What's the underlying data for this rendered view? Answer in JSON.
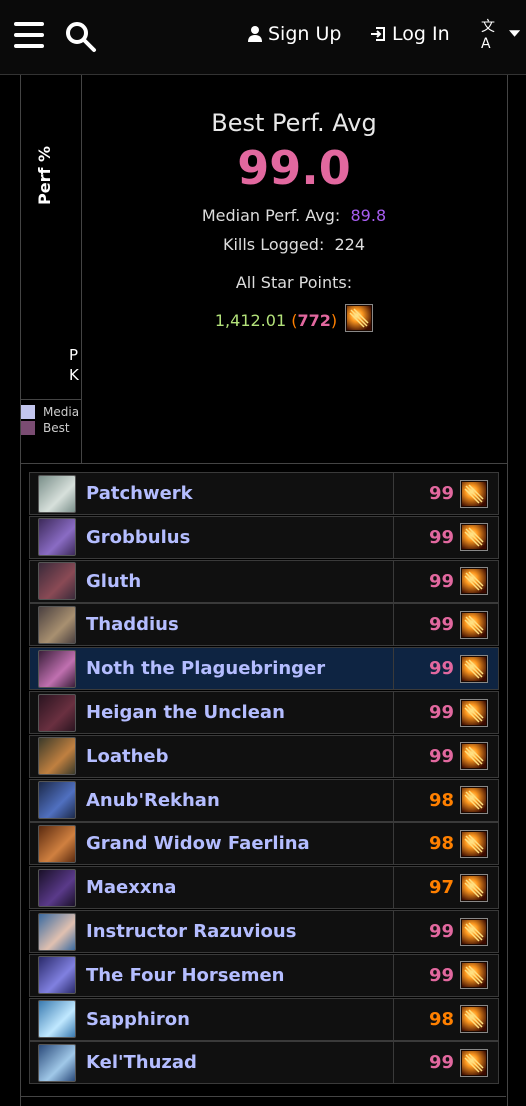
{
  "nav": {
    "signup": "Sign Up",
    "login": "Log In",
    "lang_glyph": "文A"
  },
  "stats": {
    "side_title": "Perf %",
    "side_pk": [
      "P",
      "K"
    ],
    "legend": [
      {
        "label": "Media",
        "color": "#c3c6ee"
      },
      {
        "label": "Best",
        "color": "#7a4c72"
      }
    ],
    "best_label": "Best Perf. Avg",
    "best_value": "99.0",
    "median_label": "Median Perf. Avg:",
    "median_value": "89.8",
    "kills_label": "Kills Logged:",
    "kills_value": "224",
    "star_label": "All Star Points:",
    "star_points": "1,412.01",
    "star_rank": "772"
  },
  "colors": {
    "pink": "#e2689f",
    "orange": "#ff8000",
    "name": "#b4bdff"
  },
  "bosses": [
    {
      "name": "Patchwerk",
      "score": "99",
      "tier": "pink",
      "av": [
        "#7a8f8a",
        "#d7e0db"
      ]
    },
    {
      "name": "Grobbulus",
      "score": "99",
      "tier": "pink",
      "av": [
        "#3d2a5a",
        "#8a6cc4"
      ]
    },
    {
      "name": "Gluth",
      "score": "99",
      "tier": "pink",
      "av": [
        "#3a2a3a",
        "#8a4a55"
      ]
    },
    {
      "name": "Thaddius",
      "score": "99",
      "tier": "pink",
      "av": [
        "#4a4040",
        "#a89070"
      ]
    },
    {
      "name": "Noth the Plaguebringer",
      "score": "99",
      "tier": "pink",
      "av": [
        "#3a1f3a",
        "#c070b0"
      ],
      "highlight": true
    },
    {
      "name": "Heigan the Unclean",
      "score": "99",
      "tier": "pink",
      "av": [
        "#2a1420",
        "#6a3040"
      ]
    },
    {
      "name": "Loatheb",
      "score": "99",
      "tier": "pink",
      "av": [
        "#3a3a2a",
        "#c08040"
      ]
    },
    {
      "name": "Anub'Rekhan",
      "score": "98",
      "tier": "orange",
      "av": [
        "#1c2a4a",
        "#5070c0"
      ]
    },
    {
      "name": "Grand Widow Faerlina",
      "score": "98",
      "tier": "orange",
      "av": [
        "#5a2a10",
        "#d08040"
      ]
    },
    {
      "name": "Maexxna",
      "score": "97",
      "tier": "orange",
      "av": [
        "#1a1028",
        "#5a3a8a"
      ]
    },
    {
      "name": "Instructor Razuvious",
      "score": "99",
      "tier": "pink",
      "av": [
        "#3a6aa0",
        "#e0c0b0"
      ]
    },
    {
      "name": "The Four Horsemen",
      "score": "99",
      "tier": "pink",
      "av": [
        "#2a2a6a",
        "#8080e0"
      ]
    },
    {
      "name": "Sapphiron",
      "score": "98",
      "tier": "orange",
      "av": [
        "#3a7ab0",
        "#c0e8ff"
      ]
    },
    {
      "name": "Kel'Thuzad",
      "score": "99",
      "tier": "pink",
      "av": [
        "#2a4a7a",
        "#a0c8e8"
      ]
    }
  ]
}
